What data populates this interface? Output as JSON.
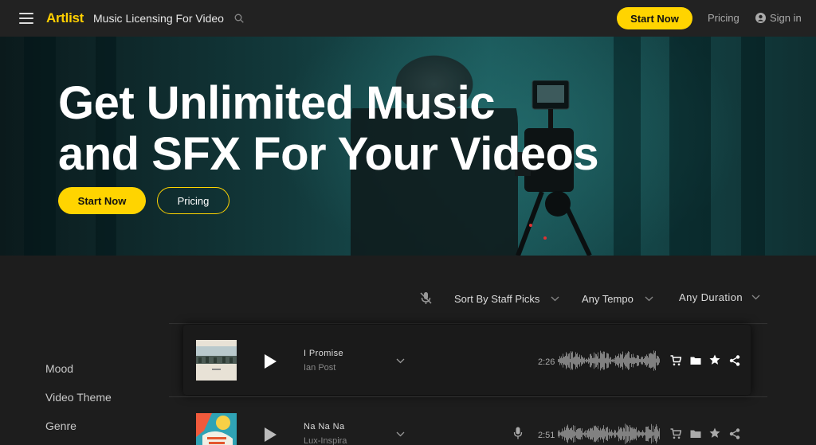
{
  "header": {
    "logo": "Artlist",
    "title": "Music Licensing For Video",
    "start_label": "Start Now",
    "pricing_label": "Pricing",
    "signin_label": "Sign in"
  },
  "hero": {
    "line1": "Get Unlimited Music",
    "line2": "and SFX For Your Videos",
    "start_label": "Start Now",
    "pricing_label": "Pricing"
  },
  "filters": {
    "sort": "Sort By Staff Picks",
    "tempo": "Any Tempo",
    "duration": "Any Duration"
  },
  "sidebar": {
    "items": [
      {
        "label": "Mood"
      },
      {
        "label": "Video Theme"
      },
      {
        "label": "Genre"
      }
    ]
  },
  "tracks": [
    {
      "title": "I Promise",
      "artist": "Ian Post",
      "duration": "2:26",
      "vocals": false
    },
    {
      "title": "Na Na Na",
      "artist": "Lux-Inspira",
      "duration": "2:51",
      "vocals": true
    }
  ],
  "colors": {
    "accent": "#ffd400",
    "background": "#1d1d1d",
    "topbar": "#222222"
  },
  "icons": [
    "menu-icon",
    "search-icon",
    "user-icon",
    "mic-off-icon",
    "chevron-down-icon",
    "play-icon",
    "cart-icon",
    "folder-icon",
    "star-icon",
    "share-icon",
    "mic-icon"
  ]
}
